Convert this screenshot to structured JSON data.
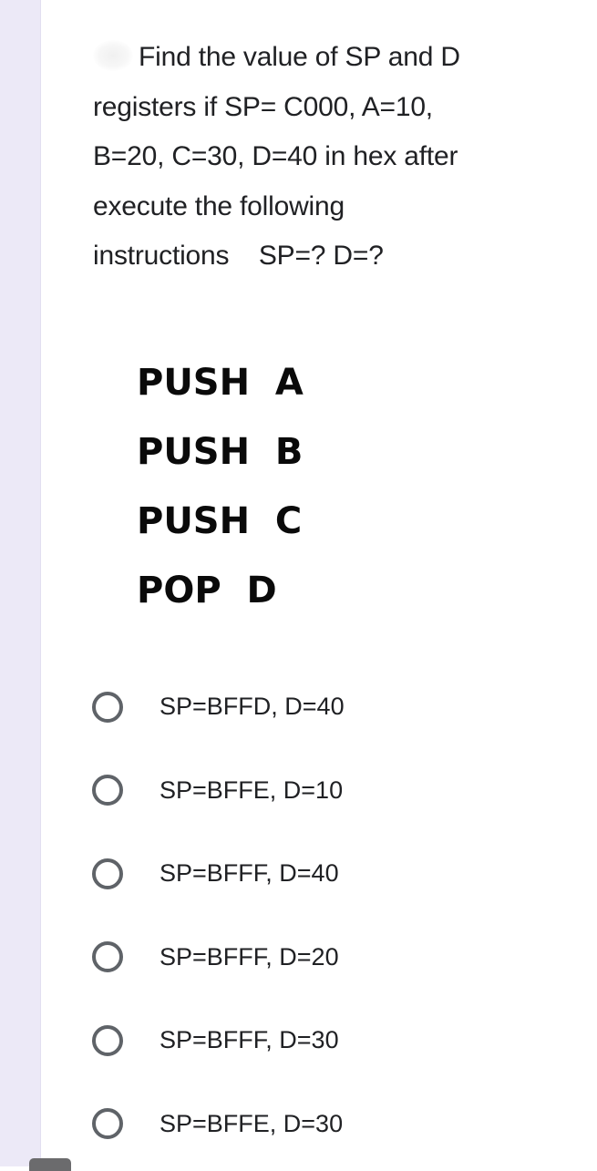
{
  "question": {
    "lines": [
      "Find the value of SP and D",
      "registers if SP= C000, A=10,",
      "B=20, C=30, D=40 in hex after",
      "execute the following",
      "instructions    SP=? D=?"
    ]
  },
  "instructions": [
    "PUSH  A",
    "PUSH  B",
    "PUSH  C",
    "POP  D"
  ],
  "options": [
    {
      "label": "SP=BFFD, D=40",
      "selected": false
    },
    {
      "label": "SP=BFFE, D=10",
      "selected": false
    },
    {
      "label": "SP=BFFF, D=40",
      "selected": false
    },
    {
      "label": "SP=BFFF, D=20",
      "selected": false
    },
    {
      "label": "SP=BFFF, D=30",
      "selected": false
    },
    {
      "label": "SP=BFFE, D=30",
      "selected": false
    }
  ],
  "colors": {
    "side_strip": "#ece9f7",
    "radio_border": "#5f6368",
    "text": "#202124"
  }
}
